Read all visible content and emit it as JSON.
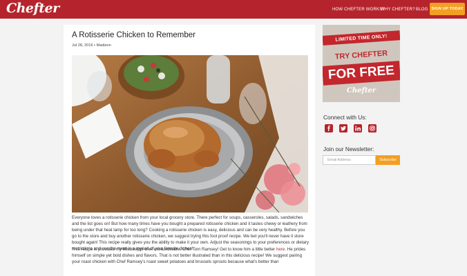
{
  "header": {
    "logo": "Chefter",
    "nav": {
      "how": "HOW CHEFTER WORKS?",
      "why": "WHY CHEFTER?",
      "blog": "BLOG"
    },
    "signup_label": "SIGN UP TODAY",
    "brand_color": "#b5242c",
    "accent_color": "#f39f21"
  },
  "post": {
    "title": "A Rotisserie Chicken to Remember",
    "meta": "Jul 28, 2016 • Madison",
    "paragraph1": "Everyone loves a rotisserie chicken from your local grocery store. There perfect for soups, casseroles, salads, sandwiches and the list goes on! But how many times have you bought a prepared rotisserie chicken and it tastes chewy or leathery from being under that heat lamp for too long? Cooking a rotisserie chicken is easy, delicious and can be very healthy. Before you go to the store and buy another rotisserie chicken, we suggest trying this fool proof recipe. We bet you'll never have it store bought again! This recipe really gives you the ability to make it your own. Adjust the seasonings to your preferences or dietary restrictions and use the meat in a myriad of your favorite dishes!",
    "paragraph2_before": "This recipe is provided my Mississippi chef extraordinaire, Chef Tom Ramsey! Get to know him a little better ",
    "paragraph2_link": "here",
    "paragraph2_after": ". He prides himself on simple yet bold dishes and flavors. That is not better illustrated than in this delicious recipe! We suggest pairing your roast chicken with Chef Ramsey's roast sweet potatoes and brussels sprouts because what's better than"
  },
  "sidebar": {
    "promo": {
      "line1": "LIMITED TIME ONLY!",
      "line2": "TRY CHEFTER",
      "line3": "FOR FREE",
      "brand": "Chefter"
    },
    "connect_heading": "Connect with Us:",
    "social_icons": [
      "facebook-icon",
      "twitter-icon",
      "linkedin-icon",
      "instagram-icon"
    ],
    "newsletter_heading": "Join our Newsletter:",
    "email_placeholder": "Email Address",
    "subscribe_label": "Subscribe"
  }
}
